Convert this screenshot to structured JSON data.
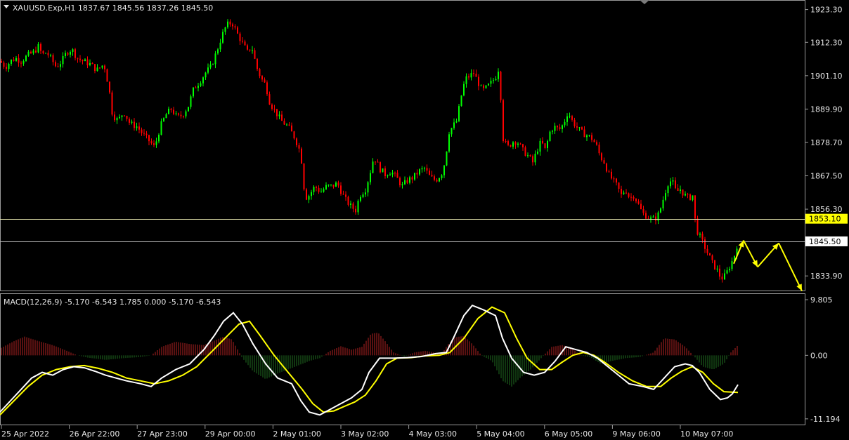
{
  "header": {
    "symbol_line": "XAUUSD.Exp,H1  1837.67 1845.56 1837.26 1845.50"
  },
  "macd_header": {
    "text": "MACD(12,26,9) -5.170 -6.543 1.785 0.000 -5.170 -6.543"
  },
  "colors": {
    "background": "#000000",
    "bull": "#00ff00",
    "bear": "#ff0000",
    "hist_up": "#b22222",
    "hist_down": "#1f6b1f",
    "macd_line": "#ffffff",
    "signal_line": "#ffff00",
    "arrow": "#ffff00",
    "level_line": "#e8e8b0",
    "level_label_bg": "#ffff00"
  },
  "price_axis": {
    "ticks": [
      "1923.30",
      "1912.30",
      "1901.10",
      "1889.90",
      "1878.70",
      "1867.50",
      "1856.30",
      "1833.90"
    ],
    "level_label": "1853.10",
    "current_label": "1845.50"
  },
  "macd_axis": {
    "ticks": [
      "9.805",
      "0.00",
      "-11.194"
    ]
  },
  "time_axis": {
    "labels": [
      "25 Apr 2022",
      "26 Apr 22:00",
      "27 Apr 23:00",
      "29 Apr 00:00",
      "2 May 01:00",
      "3 May 02:00",
      "4 May 03:00",
      "5 May 04:00",
      "6 May 05:00",
      "9 May 06:00",
      "10 May 07:00"
    ]
  },
  "chart_data": {
    "type": "candlestick",
    "symbol": "XAUUSD.Exp",
    "timeframe": "H1",
    "ohlc_last": {
      "open": 1837.67,
      "high": 1845.56,
      "low": 1837.26,
      "close": 1845.5
    },
    "price_range": [
      1829.0,
      1926.5
    ],
    "horizontal_levels": [
      1853.1,
      1845.5
    ],
    "close_path": [
      [
        0,
        1906
      ],
      [
        8,
        1904
      ],
      [
        15,
        1906
      ],
      [
        22,
        1907
      ],
      [
        30,
        1906
      ],
      [
        40,
        1908
      ],
      [
        48,
        1909
      ],
      [
        55,
        1911
      ],
      [
        60,
        1908
      ],
      [
        66,
        1909
      ],
      [
        72,
        1907
      ],
      [
        80,
        1904
      ],
      [
        88,
        1906
      ],
      [
        95,
        1909
      ],
      [
        102,
        1910
      ],
      [
        110,
        1907
      ],
      [
        118,
        1906
      ],
      [
        128,
        1905
      ],
      [
        138,
        1903
      ],
      [
        148,
        1905
      ],
      [
        155,
        1897
      ],
      [
        160,
        1888
      ],
      [
        168,
        1886
      ],
      [
        176,
        1889
      ],
      [
        185,
        1885
      ],
      [
        195,
        1884
      ],
      [
        205,
        1881
      ],
      [
        213,
        1879
      ],
      [
        220,
        1877
      ],
      [
        228,
        1884
      ],
      [
        236,
        1888
      ],
      [
        244,
        1890
      ],
      [
        252,
        1887
      ],
      [
        260,
        1888
      ],
      [
        268,
        1891
      ],
      [
        276,
        1897
      ],
      [
        284,
        1899
      ],
      [
        292,
        1902
      ],
      [
        300,
        1904
      ],
      [
        308,
        1909
      ],
      [
        315,
        1914
      ],
      [
        322,
        1918
      ],
      [
        330,
        1919
      ],
      [
        338,
        1915
      ],
      [
        345,
        1912
      ],
      [
        352,
        1909
      ],
      [
        358,
        1911
      ],
      [
        365,
        1904
      ],
      [
        372,
        1900
      ],
      [
        378,
        1898
      ],
      [
        384,
        1892
      ],
      [
        392,
        1889
      ],
      [
        400,
        1886
      ],
      [
        410,
        1884
      ],
      [
        420,
        1880
      ],
      [
        428,
        1875
      ],
      [
        434,
        1860
      ],
      [
        440,
        1861
      ],
      [
        448,
        1864
      ],
      [
        456,
        1862
      ],
      [
        465,
        1864
      ],
      [
        472,
        1864
      ],
      [
        480,
        1865
      ],
      [
        490,
        1860
      ],
      [
        500,
        1857
      ],
      [
        506,
        1856
      ],
      [
        512,
        1861
      ],
      [
        520,
        1863
      ],
      [
        526,
        1868
      ],
      [
        532,
        1874
      ],
      [
        540,
        1870
      ],
      [
        548,
        1868
      ],
      [
        556,
        1869
      ],
      [
        564,
        1867
      ],
      [
        572,
        1864
      ],
      [
        580,
        1866
      ],
      [
        588,
        1867
      ],
      [
        596,
        1869
      ],
      [
        604,
        1870
      ],
      [
        612,
        1867
      ],
      [
        620,
        1866
      ],
      [
        628,
        1868
      ],
      [
        634,
        1873
      ],
      [
        638,
        1882
      ],
      [
        644,
        1884
      ],
      [
        650,
        1886
      ],
      [
        656,
        1894
      ],
      [
        662,
        1900
      ],
      [
        668,
        1901
      ],
      [
        674,
        1902
      ],
      [
        680,
        1899
      ],
      [
        686,
        1896
      ],
      [
        692,
        1897
      ],
      [
        700,
        1899
      ],
      [
        706,
        1901
      ],
      [
        710,
        1904
      ],
      [
        716,
        1880
      ],
      [
        722,
        1877
      ],
      [
        730,
        1879
      ],
      [
        736,
        1879
      ],
      [
        744,
        1876
      ],
      [
        752,
        1874
      ],
      [
        758,
        1872
      ],
      [
        764,
        1876
      ],
      [
        770,
        1879
      ],
      [
        776,
        1876
      ],
      [
        782,
        1882
      ],
      [
        788,
        1884
      ],
      [
        796,
        1883
      ],
      [
        802,
        1885
      ],
      [
        808,
        1889
      ],
      [
        814,
        1886
      ],
      [
        820,
        1884
      ],
      [
        828,
        1882
      ],
      [
        836,
        1881
      ],
      [
        842,
        1880
      ],
      [
        848,
        1878
      ],
      [
        854,
        1874
      ],
      [
        860,
        1872
      ],
      [
        866,
        1868
      ],
      [
        872,
        1866
      ],
      [
        878,
        1864
      ],
      [
        884,
        1861
      ],
      [
        890,
        1863
      ],
      [
        896,
        1860
      ],
      [
        902,
        1861
      ],
      [
        908,
        1858
      ],
      [
        914,
        1855
      ],
      [
        920,
        1854
      ],
      [
        926,
        1853
      ],
      [
        932,
        1853
      ],
      [
        938,
        1855
      ],
      [
        944,
        1860
      ],
      [
        950,
        1865
      ],
      [
        956,
        1866
      ],
      [
        962,
        1862
      ],
      [
        968,
        1863
      ],
      [
        974,
        1861
      ],
      [
        980,
        1860
      ],
      [
        986,
        1861
      ],
      [
        990,
        1850
      ],
      [
        996,
        1847
      ],
      [
        1002,
        1844
      ],
      [
        1008,
        1841
      ],
      [
        1014,
        1838
      ],
      [
        1020,
        1836
      ],
      [
        1026,
        1833
      ],
      [
        1032,
        1834
      ],
      [
        1038,
        1837
      ],
      [
        1044,
        1840
      ],
      [
        1050,
        1845.5
      ]
    ],
    "projection_arrows": [
      [
        [
          1044,
          1838
        ],
        [
          1058,
          1845.8
        ]
      ],
      [
        [
          1058,
          1845.8
        ],
        [
          1078,
          1836.9
        ]
      ],
      [
        [
          1078,
          1836.9
        ],
        [
          1108,
          1844.9
        ]
      ],
      [
        [
          1108,
          1844.9
        ],
        [
          1141,
          1828.9
        ]
      ]
    ],
    "macd": {
      "params": "12,26,9",
      "macd_value": -5.17,
      "signal_value": -6.543,
      "histogram_value": 1.785,
      "range": [
        -11.194,
        9.805
      ],
      "macd_path": [
        [
          0,
          -10
        ],
        [
          15,
          -8
        ],
        [
          30,
          -6
        ],
        [
          45,
          -4
        ],
        [
          60,
          -3
        ],
        [
          75,
          -3.5
        ],
        [
          90,
          -2.5
        ],
        [
          105,
          -2
        ],
        [
          120,
          -2.2
        ],
        [
          135,
          -2.8
        ],
        [
          150,
          -3.5
        ],
        [
          165,
          -4
        ],
        [
          180,
          -4.5
        ],
        [
          200,
          -5
        ],
        [
          215,
          -5.5
        ],
        [
          230,
          -4
        ],
        [
          250,
          -2.5
        ],
        [
          270,
          -1.5
        ],
        [
          290,
          1
        ],
        [
          305,
          3.5
        ],
        [
          318,
          6
        ],
        [
          332,
          7.5
        ],
        [
          345,
          5.5
        ],
        [
          360,
          2
        ],
        [
          378,
          -1.5
        ],
        [
          395,
          -4
        ],
        [
          415,
          -5
        ],
        [
          428,
          -8
        ],
        [
          440,
          -10
        ],
        [
          455,
          -10.5
        ],
        [
          470,
          -9.5
        ],
        [
          485,
          -8.5
        ],
        [
          500,
          -7.5
        ],
        [
          515,
          -6
        ],
        [
          525,
          -3
        ],
        [
          540,
          -0.5
        ],
        [
          560,
          -0.5
        ],
        [
          580,
          -0.4
        ],
        [
          600,
          -0.2
        ],
        [
          620,
          0.3
        ],
        [
          635,
          0.5
        ],
        [
          645,
          3
        ],
        [
          660,
          7
        ],
        [
          672,
          8.8
        ],
        [
          688,
          8
        ],
        [
          705,
          7
        ],
        [
          715,
          3
        ],
        [
          728,
          -0.5
        ],
        [
          745,
          -3
        ],
        [
          760,
          -3.5
        ],
        [
          775,
          -3
        ],
        [
          790,
          -1
        ],
        [
          805,
          1.5
        ],
        [
          820,
          1
        ],
        [
          835,
          0.5
        ],
        [
          850,
          -0.5
        ],
        [
          865,
          -2
        ],
        [
          880,
          -3.5
        ],
        [
          895,
          -5
        ],
        [
          915,
          -5.5
        ],
        [
          930,
          -6
        ],
        [
          945,
          -4
        ],
        [
          960,
          -2
        ],
        [
          975,
          -1.5
        ],
        [
          985,
          -1.8
        ],
        [
          995,
          -3
        ],
        [
          1010,
          -6
        ],
        [
          1025,
          -7.8
        ],
        [
          1035,
          -7.5
        ],
        [
          1042,
          -6.8
        ],
        [
          1050,
          -5.17
        ]
      ],
      "signal_path": [
        [
          0,
          -10.5
        ],
        [
          20,
          -8
        ],
        [
          40,
          -5.5
        ],
        [
          60,
          -3.5
        ],
        [
          80,
          -2.5
        ],
        [
          100,
          -2
        ],
        [
          120,
          -1.8
        ],
        [
          140,
          -2.3
        ],
        [
          160,
          -3
        ],
        [
          180,
          -4
        ],
        [
          200,
          -4.5
        ],
        [
          220,
          -5
        ],
        [
          240,
          -4.5
        ],
        [
          260,
          -3.5
        ],
        [
          280,
          -2
        ],
        [
          300,
          0.5
        ],
        [
          320,
          3
        ],
        [
          340,
          5.5
        ],
        [
          355,
          6
        ],
        [
          370,
          3.5
        ],
        [
          390,
          0
        ],
        [
          410,
          -3
        ],
        [
          430,
          -6
        ],
        [
          445,
          -8.5
        ],
        [
          460,
          -10
        ],
        [
          475,
          -9.8
        ],
        [
          490,
          -9
        ],
        [
          505,
          -8.2
        ],
        [
          520,
          -7
        ],
        [
          535,
          -4.5
        ],
        [
          550,
          -1.5
        ],
        [
          565,
          -0.5
        ],
        [
          585,
          -0.4
        ],
        [
          605,
          -0.1
        ],
        [
          625,
          0
        ],
        [
          640,
          0.5
        ],
        [
          660,
          3
        ],
        [
          680,
          6.5
        ],
        [
          700,
          8.5
        ],
        [
          718,
          7.5
        ],
        [
          735,
          3
        ],
        [
          750,
          -0.5
        ],
        [
          768,
          -2.5
        ],
        [
          785,
          -2.5
        ],
        [
          800,
          -1.2
        ],
        [
          815,
          0
        ],
        [
          830,
          0.5
        ],
        [
          845,
          0
        ],
        [
          860,
          -1.2
        ],
        [
          880,
          -3
        ],
        [
          900,
          -4.5
        ],
        [
          920,
          -5.5
        ],
        [
          940,
          -5.5
        ],
        [
          955,
          -4
        ],
        [
          970,
          -2.8
        ],
        [
          985,
          -2
        ],
        [
          1000,
          -3
        ],
        [
          1015,
          -5
        ],
        [
          1030,
          -6.4
        ],
        [
          1050,
          -6.543
        ]
      ],
      "histogram_envelope": [
        [
          0,
          1.2
        ],
        [
          20,
          2.5
        ],
        [
          35,
          3.3
        ],
        [
          55,
          2.5
        ],
        [
          75,
          1.8
        ],
        [
          95,
          0.8
        ],
        [
          110,
          0
        ],
        [
          125,
          -0.4
        ],
        [
          150,
          -0.8
        ],
        [
          175,
          -0.5
        ],
        [
          200,
          -0.3
        ],
        [
          215,
          0
        ],
        [
          230,
          1.5
        ],
        [
          250,
          2.4
        ],
        [
          270,
          2
        ],
        [
          290,
          1.8
        ],
        [
          305,
          2.6
        ],
        [
          318,
          3.3
        ],
        [
          330,
          2.8
        ],
        [
          345,
          -0.5
        ],
        [
          360,
          -2.8
        ],
        [
          378,
          -4.2
        ],
        [
          395,
          -3.2
        ],
        [
          420,
          -2
        ],
        [
          440,
          -1
        ],
        [
          455,
          -0.5
        ],
        [
          470,
          0.8
        ],
        [
          485,
          1.6
        ],
        [
          500,
          1
        ],
        [
          515,
          1.5
        ],
        [
          528,
          3.8
        ],
        [
          538,
          4
        ],
        [
          548,
          2.5
        ],
        [
          560,
          0.5
        ],
        [
          575,
          -0.2
        ],
        [
          590,
          0.5
        ],
        [
          605,
          0.8
        ],
        [
          618,
          0.5
        ],
        [
          628,
          0.2
        ],
        [
          638,
          2
        ],
        [
          648,
          3.2
        ],
        [
          660,
          3.4
        ],
        [
          672,
          2
        ],
        [
          685,
          0
        ],
        [
          700,
          -1
        ],
        [
          715,
          -4.5
        ],
        [
          728,
          -5.5
        ],
        [
          740,
          -4
        ],
        [
          755,
          -2.5
        ],
        [
          770,
          -0.5
        ],
        [
          785,
          1.5
        ],
        [
          800,
          1.8
        ],
        [
          815,
          1.2
        ],
        [
          825,
          0
        ],
        [
          840,
          -0.3
        ],
        [
          855,
          -1.5
        ],
        [
          870,
          -1
        ],
        [
          890,
          -0.5
        ],
        [
          910,
          -0.3
        ],
        [
          930,
          0.5
        ],
        [
          945,
          3
        ],
        [
          960,
          2.8
        ],
        [
          975,
          1.5
        ],
        [
          990,
          -0.5
        ],
        [
          1000,
          -2
        ],
        [
          1015,
          -2.5
        ],
        [
          1030,
          -1.5
        ],
        [
          1040,
          0.5
        ],
        [
          1050,
          1.785
        ]
      ]
    }
  }
}
